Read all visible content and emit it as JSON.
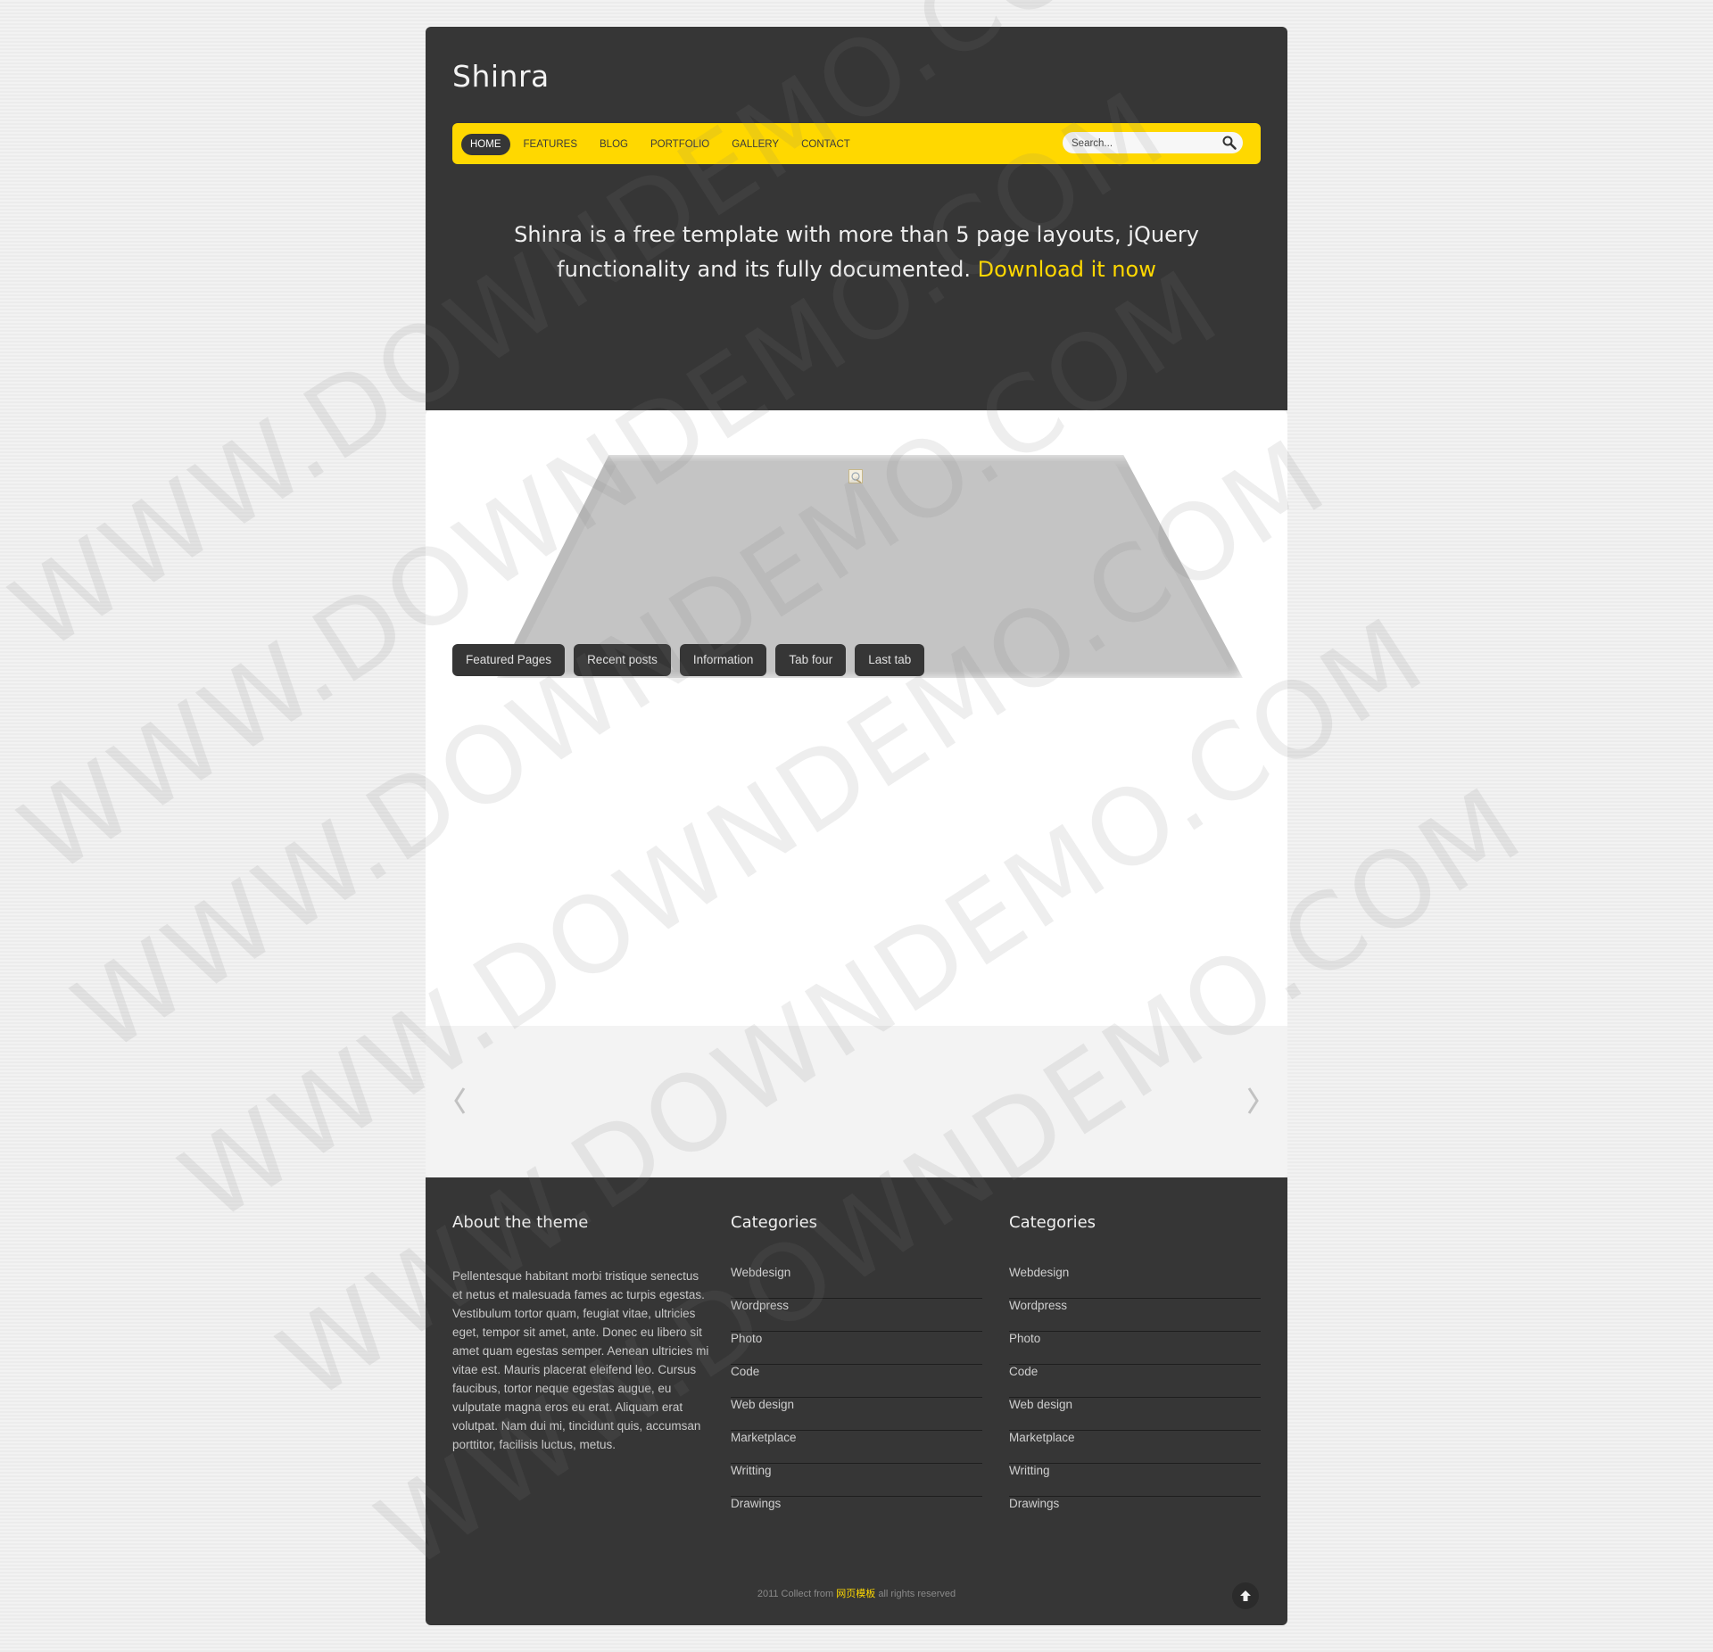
{
  "site": {
    "title": "Shinra"
  },
  "nav": {
    "items": [
      {
        "label": "HOME",
        "active": true
      },
      {
        "label": "FEATURES",
        "active": false
      },
      {
        "label": "BLOG",
        "active": false
      },
      {
        "label": "PORTFOLIO",
        "active": false
      },
      {
        "label": "GALLERY",
        "active": false
      },
      {
        "label": "CONTACT",
        "active": false
      }
    ],
    "search_placeholder": "Search..."
  },
  "hero": {
    "text": "Shinra is a free template with more than 5 page layouts, jQuery functionality and its fully documented. ",
    "link": "Download it now"
  },
  "tabs": [
    "Featured Pages",
    "Recent posts",
    "Information",
    "Tab four",
    "Last tab"
  ],
  "slider": {
    "prev_icon": "chevron-left-icon",
    "next_icon": "chevron-right-icon"
  },
  "footer": {
    "about_title": "About the theme",
    "about_text": "Pellentesque habitant morbi tristique senectus et netus et malesuada fames ac turpis egestas. Vestibulum tortor quam, feugiat vitae, ultricies eget, tempor sit amet, ante. Donec eu libero sit amet quam egestas semper. Aenean ultricies mi vitae est. Mauris placerat eleifend leo. Cursus faucibus, tortor neque egestas augue, eu vulputate magna eros eu erat. Aliquam erat volutpat. Nam dui mi, tincidunt quis, accumsan porttitor, facilisis luctus, metus.",
    "cat1_title": "Categories",
    "cat2_title": "Categories",
    "categories": [
      "Webdesign",
      "Wordpress",
      "Photo",
      "Code",
      "Web design",
      "Marketplace",
      "Writting",
      "Drawings"
    ],
    "copyright_pre": "2011 Collect from ",
    "copyright_link": "网页模板",
    "copyright_post": " all rights reserved",
    "top_icon": "arrow-up-icon"
  },
  "watermark": "WWW.DOWNDEMO.COM",
  "colors": {
    "accent": "#ffd800",
    "dark": "#363636",
    "background": "#efefef"
  }
}
